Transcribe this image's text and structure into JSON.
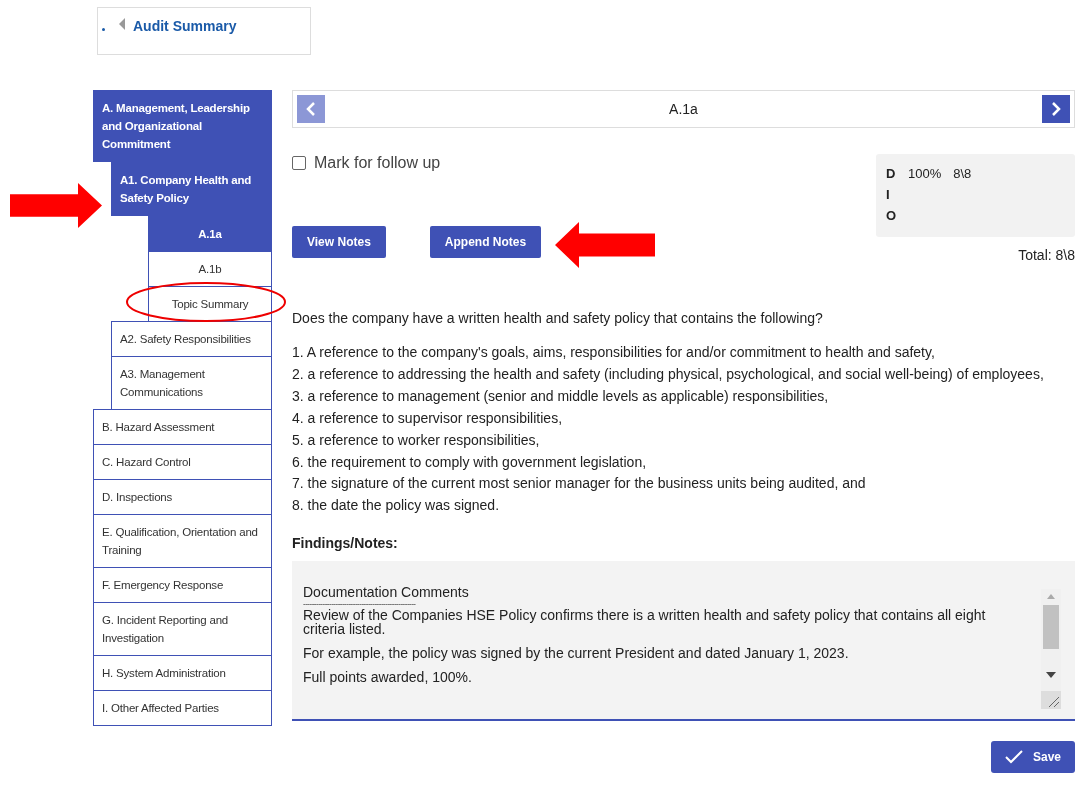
{
  "header": {
    "title": "Audit Summary"
  },
  "sidebar": {
    "items": [
      {
        "label": "A. Management, Leadership and Organizational Commitment",
        "selected": true,
        "children": [
          {
            "label": "A1. Company Health and Safety Policy",
            "selected": true,
            "children": [
              {
                "label": "A.1a",
                "selected": true
              },
              {
                "label": "A.1b",
                "selected": false
              },
              {
                "label": "Topic Summary",
                "selected": false
              }
            ]
          },
          {
            "label": "A2. Safety Responsibilities",
            "selected": false
          },
          {
            "label": "A3. Management Communications",
            "selected": false
          }
        ]
      },
      {
        "label": "B. Hazard Assessment",
        "selected": false
      },
      {
        "label": "C. Hazard Control",
        "selected": false
      },
      {
        "label": "D. Inspections",
        "selected": false
      },
      {
        "label": "E. Qualification, Orientation and Training",
        "selected": false
      },
      {
        "label": "F. Emergency Response",
        "selected": false
      },
      {
        "label": "G. Incident Reporting and Investigation",
        "selected": false
      },
      {
        "label": "H. System Administration",
        "selected": false
      },
      {
        "label": "I. Other Affected Parties",
        "selected": false
      }
    ]
  },
  "navigator": {
    "title": "A.1a",
    "previous_disabled": true,
    "next_disabled": false
  },
  "follow_up": {
    "label": "Mark for follow up",
    "checked": false
  },
  "buttons": [
    "View Notes",
    "Append Notes"
  ],
  "scores": [
    {
      "code": "D",
      "percent": "100%",
      "points": "8\\8"
    },
    {
      "code": "I"
    },
    {
      "code": "O"
    }
  ],
  "total": "Total: 8\\8",
  "question": "Does the company have a written health and safety policy that contains the following?",
  "criteria": [
    "1. A reference to the company's goals, aims, responsibilities for and/or commitment to health and safety,",
    "2. a reference to addressing the health and safety (including physical, psychological, and social well-being) of employees,",
    "3. a reference to management (senior and middle levels as applicable) responsibilities,",
    "4. a reference to supervisor responsibilities,",
    "5. a reference to worker responsibilities,",
    "6. the requirement to comply with government legislation,",
    "7. the signature of the current most senior manager for the business units being audited, and",
    "8. the date the policy was signed."
  ],
  "findings": {
    "label": "Findings/Notes:",
    "title": "Documentation Comments",
    "rule": "----------------------------------------------------",
    "paragraphs": [
      "Review of the Companies HSE Policy confirms there is a written health and safety policy that contains all eight criteria listed.",
      "For example, the policy was signed by the current President and dated January 1, 2023.",
      "Full points awarded, 100%."
    ]
  },
  "save": "Save",
  "annotations": [
    {
      "kind": "right-arrow"
    },
    {
      "kind": "left-arrow"
    },
    {
      "kind": "ellipse"
    }
  ]
}
